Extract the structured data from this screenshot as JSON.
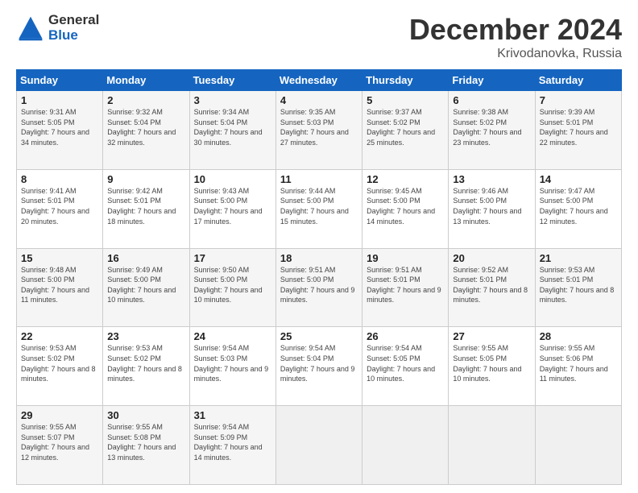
{
  "header": {
    "logo": {
      "general": "General",
      "blue": "Blue"
    },
    "title": "December 2024",
    "location": "Krivodanovka, Russia"
  },
  "days_of_week": [
    "Sunday",
    "Monday",
    "Tuesday",
    "Wednesday",
    "Thursday",
    "Friday",
    "Saturday"
  ],
  "weeks": [
    [
      {
        "day": "1",
        "sunrise": "Sunrise: 9:31 AM",
        "sunset": "Sunset: 5:05 PM",
        "daylight": "Daylight: 7 hours and 34 minutes."
      },
      {
        "day": "2",
        "sunrise": "Sunrise: 9:32 AM",
        "sunset": "Sunset: 5:04 PM",
        "daylight": "Daylight: 7 hours and 32 minutes."
      },
      {
        "day": "3",
        "sunrise": "Sunrise: 9:34 AM",
        "sunset": "Sunset: 5:04 PM",
        "daylight": "Daylight: 7 hours and 30 minutes."
      },
      {
        "day": "4",
        "sunrise": "Sunrise: 9:35 AM",
        "sunset": "Sunset: 5:03 PM",
        "daylight": "Daylight: 7 hours and 27 minutes."
      },
      {
        "day": "5",
        "sunrise": "Sunrise: 9:37 AM",
        "sunset": "Sunset: 5:02 PM",
        "daylight": "Daylight: 7 hours and 25 minutes."
      },
      {
        "day": "6",
        "sunrise": "Sunrise: 9:38 AM",
        "sunset": "Sunset: 5:02 PM",
        "daylight": "Daylight: 7 hours and 23 minutes."
      },
      {
        "day": "7",
        "sunrise": "Sunrise: 9:39 AM",
        "sunset": "Sunset: 5:01 PM",
        "daylight": "Daylight: 7 hours and 22 minutes."
      }
    ],
    [
      {
        "day": "8",
        "sunrise": "Sunrise: 9:41 AM",
        "sunset": "Sunset: 5:01 PM",
        "daylight": "Daylight: 7 hours and 20 minutes."
      },
      {
        "day": "9",
        "sunrise": "Sunrise: 9:42 AM",
        "sunset": "Sunset: 5:01 PM",
        "daylight": "Daylight: 7 hours and 18 minutes."
      },
      {
        "day": "10",
        "sunrise": "Sunrise: 9:43 AM",
        "sunset": "Sunset: 5:00 PM",
        "daylight": "Daylight: 7 hours and 17 minutes."
      },
      {
        "day": "11",
        "sunrise": "Sunrise: 9:44 AM",
        "sunset": "Sunset: 5:00 PM",
        "daylight": "Daylight: 7 hours and 15 minutes."
      },
      {
        "day": "12",
        "sunrise": "Sunrise: 9:45 AM",
        "sunset": "Sunset: 5:00 PM",
        "daylight": "Daylight: 7 hours and 14 minutes."
      },
      {
        "day": "13",
        "sunrise": "Sunrise: 9:46 AM",
        "sunset": "Sunset: 5:00 PM",
        "daylight": "Daylight: 7 hours and 13 minutes."
      },
      {
        "day": "14",
        "sunrise": "Sunrise: 9:47 AM",
        "sunset": "Sunset: 5:00 PM",
        "daylight": "Daylight: 7 hours and 12 minutes."
      }
    ],
    [
      {
        "day": "15",
        "sunrise": "Sunrise: 9:48 AM",
        "sunset": "Sunset: 5:00 PM",
        "daylight": "Daylight: 7 hours and 11 minutes."
      },
      {
        "day": "16",
        "sunrise": "Sunrise: 9:49 AM",
        "sunset": "Sunset: 5:00 PM",
        "daylight": "Daylight: 7 hours and 10 minutes."
      },
      {
        "day": "17",
        "sunrise": "Sunrise: 9:50 AM",
        "sunset": "Sunset: 5:00 PM",
        "daylight": "Daylight: 7 hours and 10 minutes."
      },
      {
        "day": "18",
        "sunrise": "Sunrise: 9:51 AM",
        "sunset": "Sunset: 5:00 PM",
        "daylight": "Daylight: 7 hours and 9 minutes."
      },
      {
        "day": "19",
        "sunrise": "Sunrise: 9:51 AM",
        "sunset": "Sunset: 5:01 PM",
        "daylight": "Daylight: 7 hours and 9 minutes."
      },
      {
        "day": "20",
        "sunrise": "Sunrise: 9:52 AM",
        "sunset": "Sunset: 5:01 PM",
        "daylight": "Daylight: 7 hours and 8 minutes."
      },
      {
        "day": "21",
        "sunrise": "Sunrise: 9:53 AM",
        "sunset": "Sunset: 5:01 PM",
        "daylight": "Daylight: 7 hours and 8 minutes."
      }
    ],
    [
      {
        "day": "22",
        "sunrise": "Sunrise: 9:53 AM",
        "sunset": "Sunset: 5:02 PM",
        "daylight": "Daylight: 7 hours and 8 minutes."
      },
      {
        "day": "23",
        "sunrise": "Sunrise: 9:53 AM",
        "sunset": "Sunset: 5:02 PM",
        "daylight": "Daylight: 7 hours and 8 minutes."
      },
      {
        "day": "24",
        "sunrise": "Sunrise: 9:54 AM",
        "sunset": "Sunset: 5:03 PM",
        "daylight": "Daylight: 7 hours and 9 minutes."
      },
      {
        "day": "25",
        "sunrise": "Sunrise: 9:54 AM",
        "sunset": "Sunset: 5:04 PM",
        "daylight": "Daylight: 7 hours and 9 minutes."
      },
      {
        "day": "26",
        "sunrise": "Sunrise: 9:54 AM",
        "sunset": "Sunset: 5:05 PM",
        "daylight": "Daylight: 7 hours and 10 minutes."
      },
      {
        "day": "27",
        "sunrise": "Sunrise: 9:55 AM",
        "sunset": "Sunset: 5:05 PM",
        "daylight": "Daylight: 7 hours and 10 minutes."
      },
      {
        "day": "28",
        "sunrise": "Sunrise: 9:55 AM",
        "sunset": "Sunset: 5:06 PM",
        "daylight": "Daylight: 7 hours and 11 minutes."
      }
    ],
    [
      {
        "day": "29",
        "sunrise": "Sunrise: 9:55 AM",
        "sunset": "Sunset: 5:07 PM",
        "daylight": "Daylight: 7 hours and 12 minutes."
      },
      {
        "day": "30",
        "sunrise": "Sunrise: 9:55 AM",
        "sunset": "Sunset: 5:08 PM",
        "daylight": "Daylight: 7 hours and 13 minutes."
      },
      {
        "day": "31",
        "sunrise": "Sunrise: 9:54 AM",
        "sunset": "Sunset: 5:09 PM",
        "daylight": "Daylight: 7 hours and 14 minutes."
      },
      null,
      null,
      null,
      null
    ]
  ]
}
